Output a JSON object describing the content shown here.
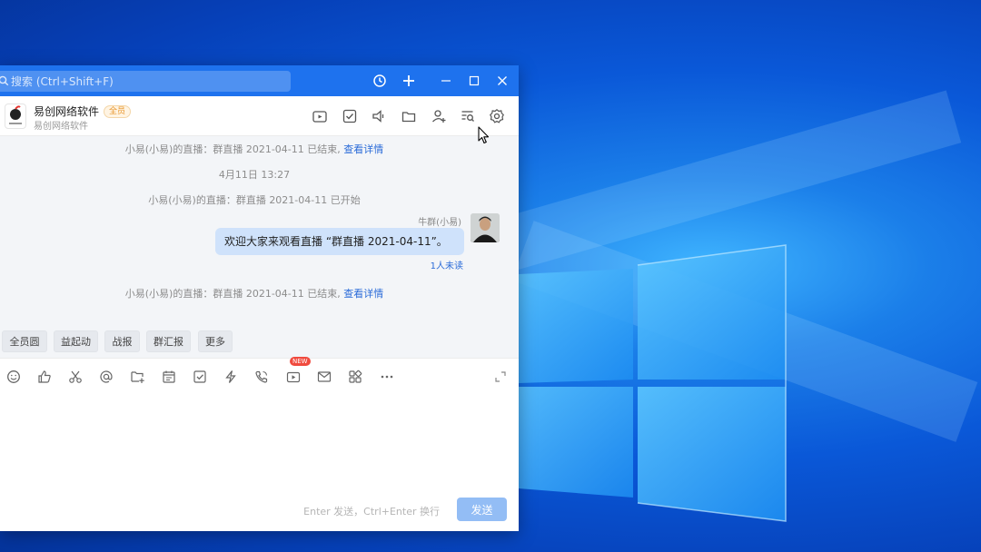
{
  "window": {
    "search_placeholder": "搜索 (Ctrl+Shift+F)"
  },
  "chat_header": {
    "group_name": "易创网络软件",
    "badge": "全员",
    "subtitle": "易创网络软件"
  },
  "messages": {
    "sys1_text": "小易(小易)的直播：群直播 2021-04-11 已结束,",
    "sys1_link": "查看详情",
    "timestamp": "4月11日 13:27",
    "sys2_text": "小易(小易)的直播：群直播 2021-04-11 已开始",
    "sender": "牛群(小易)",
    "bubble_text": "欢迎大家来观看直播 “群直播 2021-04-11”。",
    "unread": "1人未读",
    "sys3_text": "小易(小易)的直播：群直播 2021-04-11 已结束,",
    "sys3_link": "查看详情"
  },
  "quick_replies": [
    "全员圆",
    "益起动",
    "战报",
    "群汇报",
    "更多"
  ],
  "toolbar": {
    "new_tag": "NEW",
    "icons": [
      "emoji-icon",
      "thumbs-up-icon",
      "scissors-icon",
      "mention-icon",
      "folder-add-icon",
      "calendar-icon",
      "todo-icon",
      "ding-icon",
      "phone-icon",
      "live-icon",
      "mail-icon",
      "app-icon",
      "more-icon",
      "expand-icon"
    ]
  },
  "composer": {
    "hint": "Enter 发送，Ctrl+Enter 换行",
    "send_label": "发送"
  },
  "colors": {
    "titlebar": "#1e72ee",
    "accent": "#2a6bd8",
    "bubble": "#cfe2fb",
    "send_button": "#93bdf5"
  }
}
